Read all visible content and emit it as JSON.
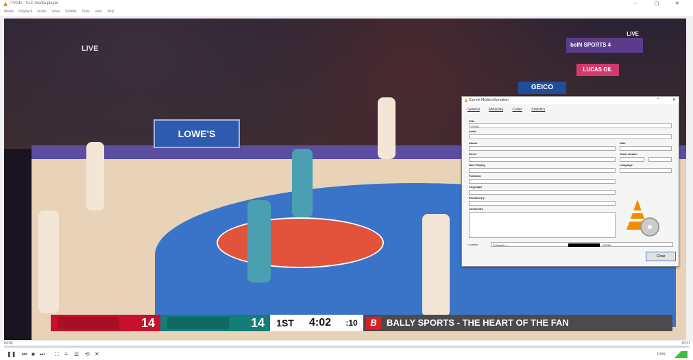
{
  "window": {
    "title": "iTVOD - VLC media player",
    "min_label": "–",
    "max_label": "▢",
    "close_label": "✕"
  },
  "menubar": [
    "Media",
    "Playback",
    "Audio",
    "Video",
    "Subtitle",
    "Tools",
    "View",
    "Help"
  ],
  "video": {
    "live_left": "LIVE",
    "bein_live": "LIVE",
    "bein_text": "beIN SPORTS 4",
    "lowes_text": "LOWE'S",
    "geico_text": "GEICO",
    "lucas_text": "LUCAS OIL",
    "scoreboard": {
      "home_score": "14",
      "away_score": "14",
      "quarter": "1ST",
      "clock": "4:02",
      "shot_clock": ":10",
      "ticker_logo": "B",
      "ticker_text": "BALLY SPORTS - THE HEART OF THE FAN",
      "home_color": "#c8102e",
      "away_color": "#137d78"
    }
  },
  "dialog": {
    "title": "Current Media Information",
    "tabs": [
      "General",
      "Metadata",
      "Codec",
      "Statistics"
    ],
    "fields": {
      "title_label": "Title",
      "title_value": "iTVOD",
      "artist_label": "Artist",
      "album_label": "Album",
      "date_label": "Date",
      "genre_label": "Genre",
      "track_label": "Track number",
      "now_playing_label": "Now Playing",
      "language_label": "Language",
      "publisher_label": "Publisher",
      "copyright_label": "Copyright",
      "encoded_label": "Encoded by",
      "comments_label": "Comments"
    },
    "location_label": "Location",
    "location_value": "C:\\Users\\...\\...",
    "location_suffix": "iTVOD",
    "close_label": "Close"
  },
  "controls": {
    "time_left": "04:06",
    "time_right": "00:21",
    "volume": "100%",
    "buttons": [
      "pause",
      "prev",
      "stop",
      "next",
      "fullscreen",
      "extended",
      "playlist",
      "loop",
      "random"
    ]
  }
}
